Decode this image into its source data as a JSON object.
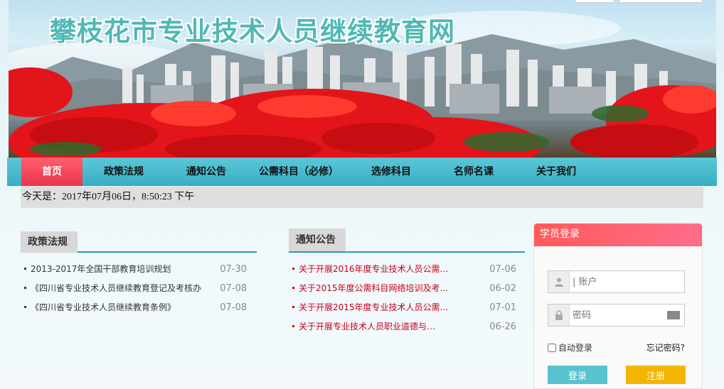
{
  "site": {
    "title": "攀枝花市专业技术人员继续教育网"
  },
  "nav": [
    {
      "label": "首页",
      "active": true
    },
    {
      "label": "政策法规"
    },
    {
      "label": "通知公告"
    },
    {
      "label": "公需科目（必修）"
    },
    {
      "label": "选修科目"
    },
    {
      "label": "名师名课"
    },
    {
      "label": "关于我们"
    }
  ],
  "date_bar": {
    "text": "今天是：2017年07月06日，8:50:23 下午"
  },
  "policy": {
    "title": "政策法规",
    "items": [
      {
        "title": "2013-2017年全国干部教育培训规划",
        "date": "07-30"
      },
      {
        "title": "《四川省专业技术人员继续教育登记及考核办",
        "date": "07-08"
      },
      {
        "title": "《四川省专业技术人员继续教育条例》",
        "date": "07-08"
      }
    ]
  },
  "notice": {
    "title": "通知公告",
    "items": [
      {
        "title": "关于开展2016年度专业技术人员公需…",
        "date": "07-06"
      },
      {
        "title": "关于2015年度公需科目网络培训及考…",
        "date": "06-02"
      },
      {
        "title": "关于开展2015年度专业技术人员公需…",
        "date": "07-01"
      },
      {
        "title": "关于开展专业技术人员职业道德与…",
        "date": "06-26"
      }
    ]
  },
  "login": {
    "title": "学员登录",
    "account_placeholder": "| 账户",
    "password_placeholder": "密码",
    "auto_login": "自动登录",
    "forgot": "忘记密码?",
    "login_button": "登录",
    "register_button": "注册"
  },
  "colors": {
    "nav": "#38aec3",
    "nav_active": "#ff5f6f",
    "login_head": "#ff5a5a",
    "login_button": "#59c2cf",
    "register_button": "#f5b400",
    "notice_text": "#c8001a"
  },
  "icons": [
    "user-icon",
    "lock-icon",
    "keyboard-icon"
  ]
}
